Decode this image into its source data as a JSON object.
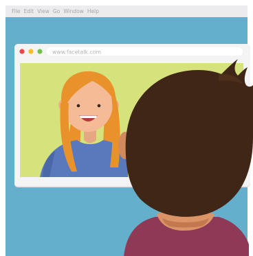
{
  "menubar": {
    "items": [
      "File",
      "Edit",
      "View",
      "Go",
      "Window",
      "Help"
    ]
  },
  "browser": {
    "url": "www.facetalk.com",
    "traffic_lights": {
      "close": "#e8474a",
      "minimize": "#f5be2b",
      "maximize": "#73c04b"
    }
  },
  "colors": {
    "menubar_bg": "#ececee",
    "menubar_text": "#a6a6aa",
    "background": "#64b0cc",
    "video_bg": "#d6e27c",
    "browser_frame": "#f2f2f2",
    "woman_hair": "#e9922c",
    "woman_skin": "#f4bb96",
    "woman_shirt": "#5a79bd",
    "man_hair": "#3f2616",
    "man_skin": "#db9468",
    "man_shirt": "#8e3a56"
  }
}
